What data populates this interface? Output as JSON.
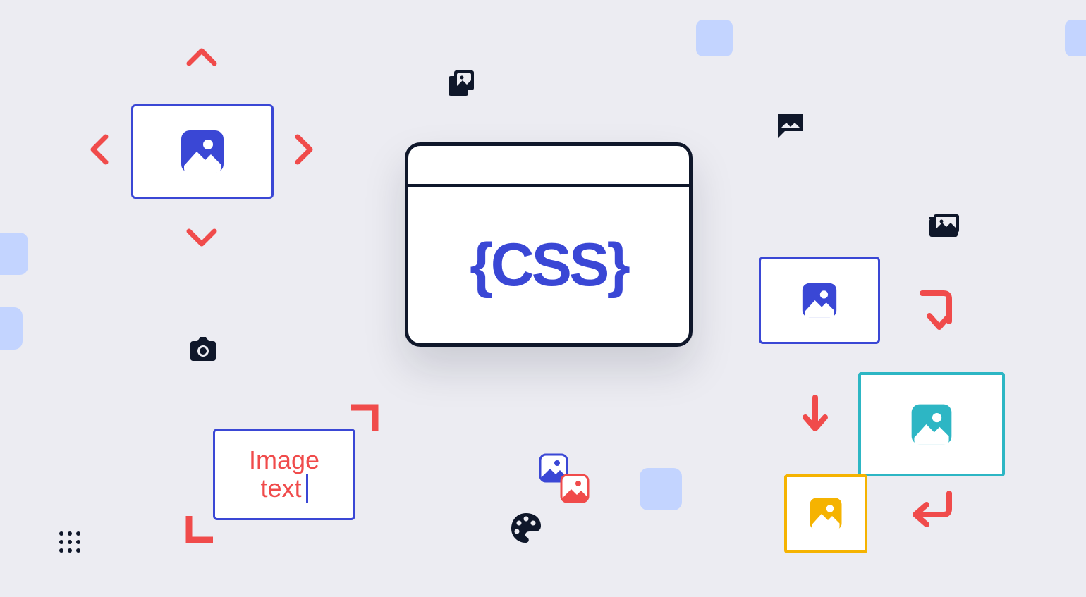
{
  "colors": {
    "bg": "#ECECF2",
    "primary_blue": "#3A47D5",
    "dark_navy": "#0F172A",
    "coral_red": "#F04B4B",
    "pale_blue": "#C3D4FF",
    "teal": "#2DB6C4",
    "amber": "#F5B301",
    "white": "#FFFFFF"
  },
  "center_window": {
    "label": "{CSS}"
  },
  "image_text_card": {
    "line1": "Image",
    "line2": "text"
  },
  "icons": [
    "image-icon",
    "chevron-up-icon",
    "chevron-down-icon",
    "chevron-left-icon",
    "chevron-right-icon",
    "camera-icon",
    "image-stack-icon",
    "chat-image-icon",
    "folder-image-icon",
    "arrow-down-icon",
    "arrow-turn-down-icon",
    "arrow-return-icon",
    "palette-icon",
    "crop-corners-icon",
    "square-decor-icon",
    "drag-handle-icon"
  ]
}
